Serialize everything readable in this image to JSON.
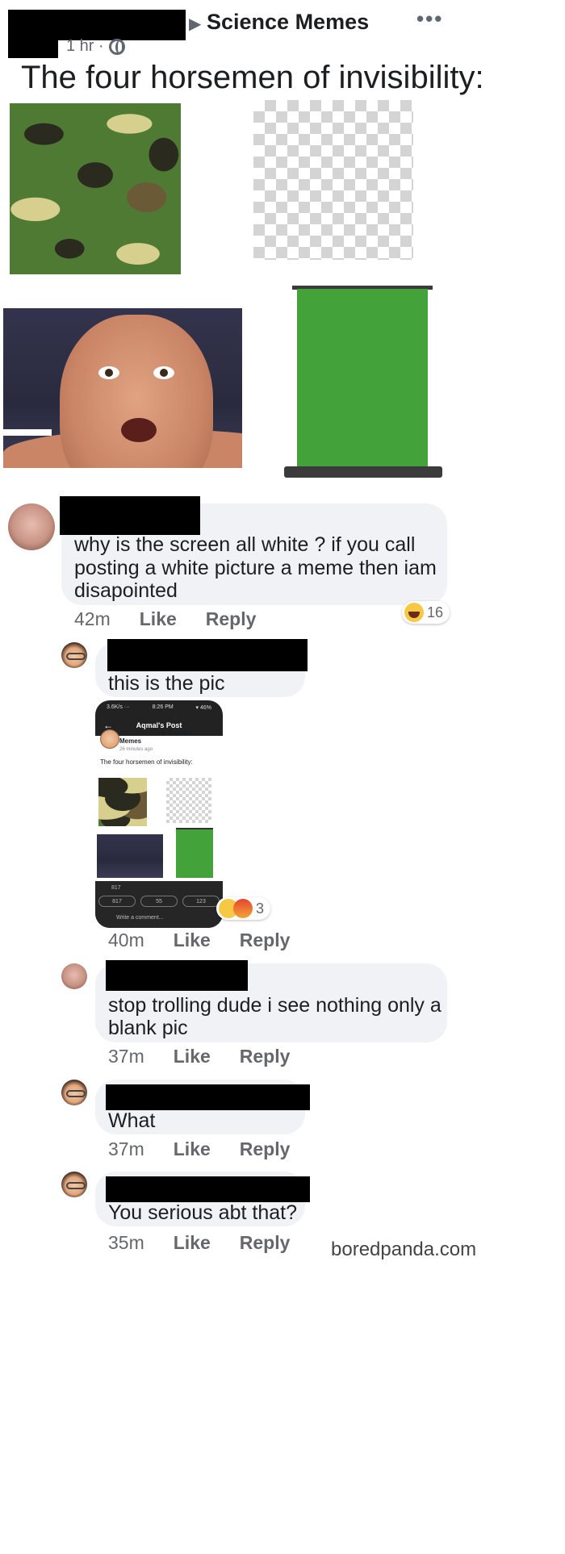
{
  "post": {
    "group_name": "Science Memes",
    "arrow": "▶",
    "time": "1 hr ·",
    "more": "•••",
    "text": "The four horsemen of invisibility:",
    "images": [
      "camouflage",
      "transparency-checkerboard",
      "john-cena",
      "green-screen"
    ]
  },
  "comments": [
    {
      "text_lines": [
        "why is the screen all white ? if you call",
        "posting a white picture a meme then iam",
        "disapointed"
      ],
      "time": "42m",
      "like": "Like",
      "reply": "Reply",
      "reaction": {
        "icon": "haha-icon",
        "count": "16"
      }
    },
    {
      "text": "this is the pic",
      "time": "40m",
      "like": "Like",
      "reply": "Reply",
      "reaction": {
        "icons": [
          "sad-icon",
          "angry-icon"
        ],
        "count": "3"
      },
      "screenshot": {
        "status_left": "3.6K/s ···",
        "status_center": "8:26 PM",
        "status_right": "▾ 46%",
        "back": "←",
        "title": "Aqmal's Post",
        "group": "▶ Science",
        "group_line2": "Memes",
        "time": "26 minutes ago",
        "more": "···",
        "text": "The four horsemen of invisibility:",
        "reaction_count": "817",
        "like_count": "817",
        "comment_count": "55",
        "share_count": "123",
        "write_placeholder": "Write a comment..."
      }
    },
    {
      "text_lines": [
        "stop trolling dude i see nothing only a",
        "blank pic"
      ],
      "time": "37m",
      "like": "Like",
      "reply": "Reply"
    },
    {
      "text": "What",
      "time": "37m",
      "like": "Like",
      "reply": "Reply"
    },
    {
      "text": "You serious abt that?",
      "time": "35m",
      "like": "Like",
      "reply": "Reply"
    }
  ],
  "watermark": "boredpanda.com"
}
